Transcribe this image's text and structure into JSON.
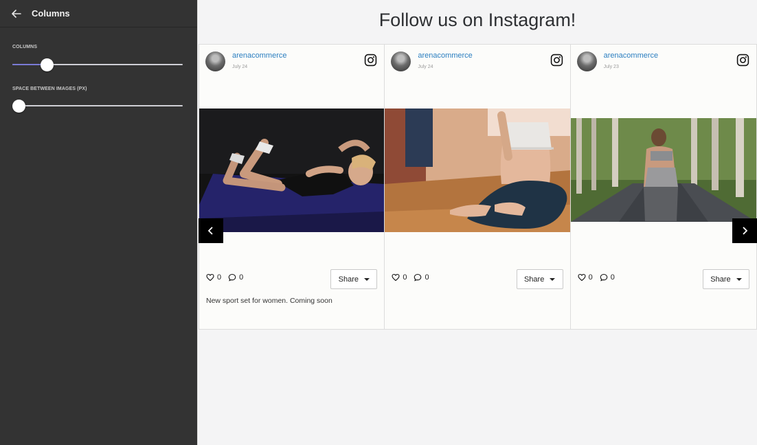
{
  "sidebar": {
    "title": "Columns",
    "columns_label": "COLUMNS",
    "columns_level": 0.2,
    "spacing_label": "SPACE BETWEEN IMAGES (PX)",
    "spacing_level": 0
  },
  "feed": {
    "title": "Follow us on Instagram!",
    "posts": [
      {
        "username": "arenacommerce",
        "date": "July 24",
        "likes": "0",
        "comments": "0",
        "share_label": "Share",
        "caption": "New sport set for women. Coming soon",
        "photo": "woman-doing-crunches-on-mat"
      },
      {
        "username": "arenacommerce",
        "date": "July 24",
        "likes": "0",
        "comments": "0",
        "share_label": "Share",
        "caption": "",
        "photo": "woman-meditating-on-floor"
      },
      {
        "username": "arenacommerce",
        "date": "July 23",
        "likes": "0",
        "comments": "0",
        "share_label": "Share",
        "caption": "",
        "photo": "woman-stretching-on-tree-lined-path"
      }
    ]
  },
  "icons": {
    "back": "arrow-left-icon",
    "instagram": "instagram-icon",
    "like": "heart-icon",
    "comment": "comment-icon",
    "prev": "chevron-left-icon",
    "next": "chevron-right-icon"
  },
  "colors": {
    "sidebar_bg": "#333333",
    "slider_accent": "#7a7bd6",
    "link": "#2a7ec0"
  }
}
